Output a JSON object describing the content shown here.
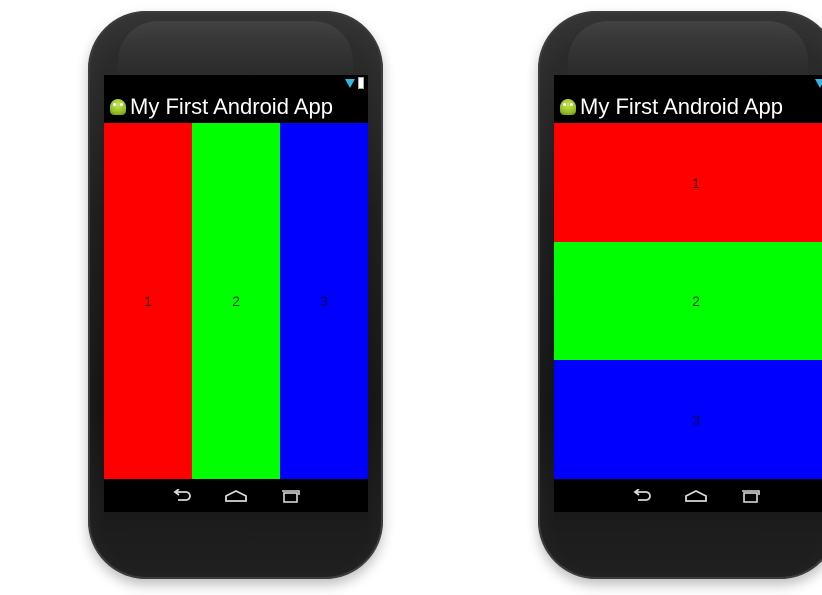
{
  "phones": [
    {
      "app_title": "My First Android App",
      "layout": "horizontal",
      "panels": [
        {
          "label": "1",
          "color": "#ff0000"
        },
        {
          "label": "2",
          "color": "#00ff00"
        },
        {
          "label": "3",
          "color": "#0000ff"
        }
      ]
    },
    {
      "app_title": "My First Android App",
      "layout": "vertical",
      "panels": [
        {
          "label": "1",
          "color": "#ff0000"
        },
        {
          "label": "2",
          "color": "#00ff00"
        },
        {
          "label": "3",
          "color": "#0000ff"
        }
      ]
    }
  ],
  "icons": {
    "app": "android-icon",
    "status": [
      "wifi-icon",
      "battery-icon"
    ],
    "nav": [
      "back-icon",
      "home-icon",
      "recent-apps-icon"
    ]
  }
}
